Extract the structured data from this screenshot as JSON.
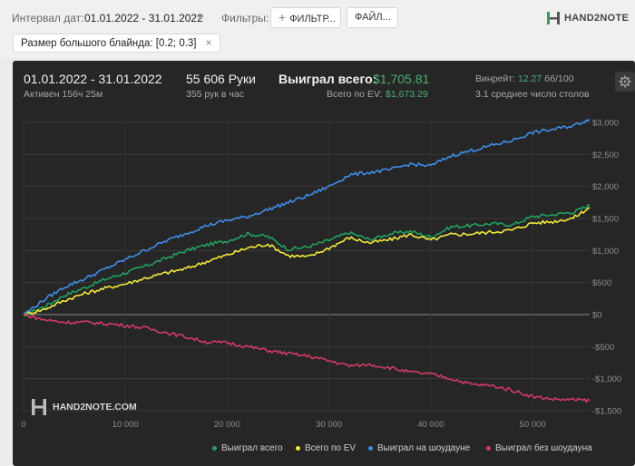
{
  "filters": {
    "interval_label": "Интервал дат:",
    "interval_value": "01.01.2022 - 31.01.2022",
    "filters_label": "Фильтры:",
    "filter_button": "ФИЛЬТР...",
    "file_button": "ФАЙЛ...",
    "chip_label": "Размер большого блайнда: [0.2; 0.3]",
    "chip_close": "×"
  },
  "brand": {
    "logo_text": "HAND2NOTE",
    "watermark_text": "HAND2NOTE.COM"
  },
  "stats": {
    "date_range": "01.01.2022 - 31.01.2022",
    "active": "Активен 156ч 25м",
    "hands": "55 606 Руки",
    "hands_per_hour": "355 рук в час",
    "won_label": "Выиграл всего:",
    "won_value": "$1,705.81",
    "ev_label": "Всего по EV:",
    "ev_value": "$1,673.29",
    "winrate_label": "Винрейт:",
    "winrate_value": "12.27",
    "winrate_unit": "бб/100",
    "tables": "3.1 среднее число столов"
  },
  "colors": {
    "won": "#21a25f",
    "ev": "#f2e93c",
    "showdown": "#3f8de6",
    "non_showdown": "#d23b63",
    "accent": "#4caf72"
  },
  "chart_data": {
    "type": "line",
    "x_ticks": [
      "0",
      "10 000",
      "20 000",
      "30 000",
      "40 000",
      "50 000"
    ],
    "y_ticks": [
      "$3,000",
      "$2,500",
      "$2,000",
      "$1,500",
      "$1,000",
      "$500",
      "$0",
      "-$500",
      "-$1,000",
      "-$1,500"
    ],
    "xlim": [
      0,
      55606
    ],
    "ylim": [
      -1500,
      3000
    ],
    "grid": true,
    "legend_position": "bottom-right",
    "x": [
      0,
      2000,
      4000,
      6000,
      8000,
      10000,
      12000,
      14000,
      16000,
      18000,
      20000,
      22000,
      24000,
      26000,
      28000,
      30000,
      32000,
      34000,
      36000,
      38000,
      40000,
      42000,
      44000,
      46000,
      48000,
      50000,
      52000,
      54000,
      55606
    ],
    "series": [
      {
        "name": "Выиграл всего",
        "color_key": "won",
        "values": [
          0,
          120,
          300,
          420,
          550,
          650,
          760,
          880,
          1000,
          1090,
          1150,
          1260,
          1220,
          1020,
          1060,
          1160,
          1280,
          1170,
          1260,
          1300,
          1210,
          1370,
          1390,
          1420,
          1400,
          1530,
          1560,
          1600,
          1706
        ]
      },
      {
        "name": "Всего по EV",
        "color_key": "ev",
        "values": [
          0,
          80,
          220,
          330,
          410,
          480,
          570,
          650,
          720,
          830,
          930,
          1040,
          1100,
          920,
          900,
          1040,
          1200,
          1120,
          1170,
          1250,
          1160,
          1250,
          1260,
          1290,
          1320,
          1430,
          1450,
          1510,
          1673
        ]
      },
      {
        "name": "Выиграл на шоудауне",
        "color_key": "showdown",
        "values": [
          0,
          230,
          430,
          560,
          710,
          860,
          1010,
          1150,
          1270,
          1390,
          1470,
          1530,
          1640,
          1750,
          1860,
          2000,
          2180,
          2220,
          2260,
          2350,
          2320,
          2480,
          2560,
          2640,
          2720,
          2840,
          2890,
          2950,
          3050
        ]
      },
      {
        "name": "Выиграл без шоудауна",
        "color_key": "non_showdown",
        "values": [
          0,
          -80,
          -120,
          -120,
          -140,
          -170,
          -210,
          -280,
          -350,
          -430,
          -440,
          -500,
          -560,
          -610,
          -650,
          -720,
          -800,
          -780,
          -830,
          -900,
          -930,
          -1000,
          -1090,
          -1110,
          -1180,
          -1280,
          -1320,
          -1330,
          -1340
        ]
      }
    ]
  }
}
